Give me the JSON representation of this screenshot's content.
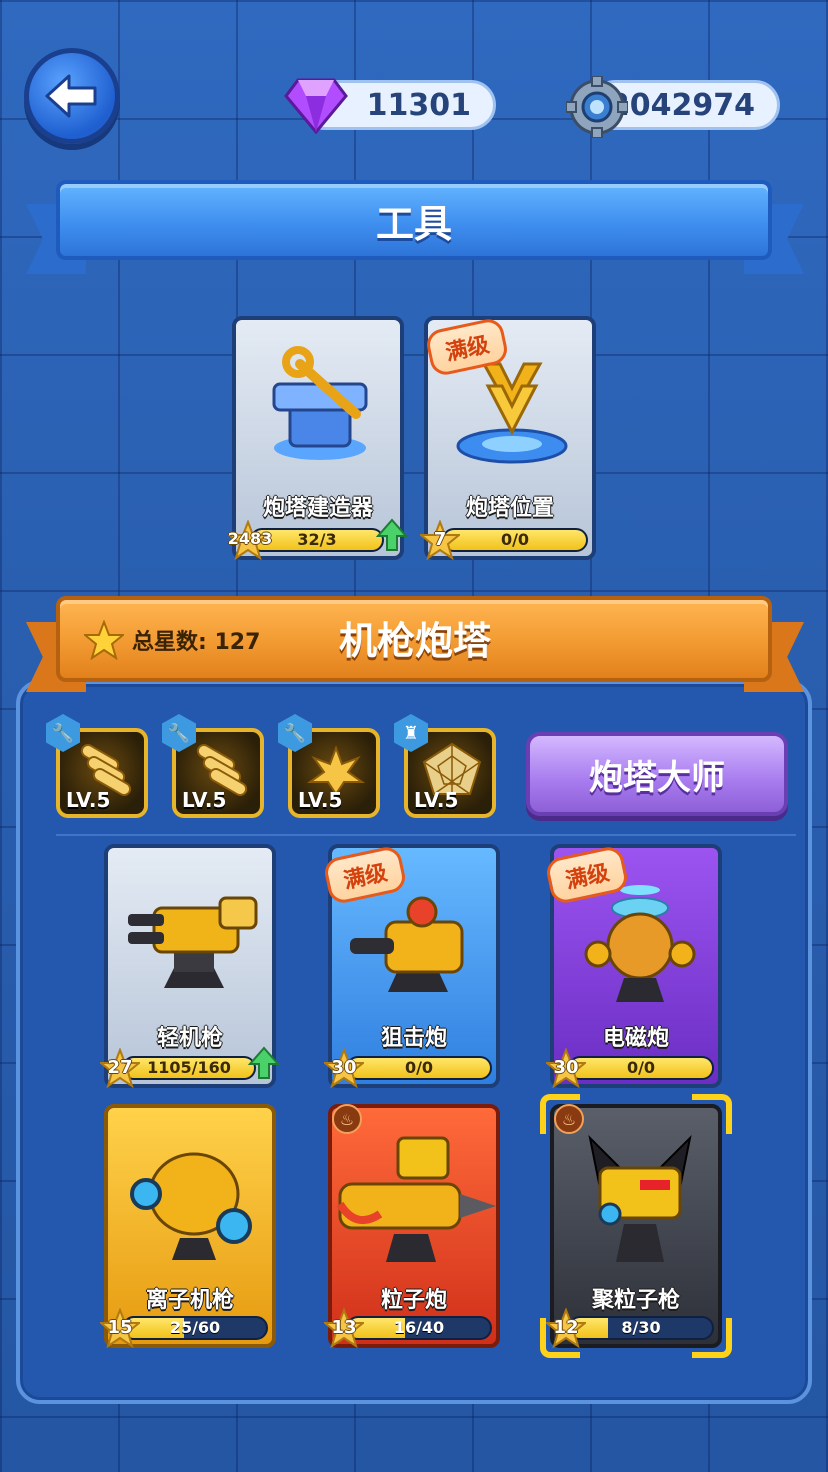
{
  "header": {
    "gems": "11301",
    "gears": "2042974"
  },
  "tools": {
    "title": "工具",
    "cards": [
      {
        "name": "炮塔建造器",
        "level": "2483",
        "progress_text": "32/3",
        "progress": 1.0,
        "upgradable": true,
        "max": false
      },
      {
        "name": "炮塔位置",
        "level": "7",
        "progress_text": "0/0",
        "progress": 1.0,
        "upgradable": false,
        "max": true,
        "max_label": "满级"
      }
    ]
  },
  "section": {
    "title": "机枪炮塔",
    "star_total_label": "总星数: 127"
  },
  "skills": [
    {
      "level": "LV.5",
      "badge": "wrench-icon"
    },
    {
      "level": "LV.5",
      "badge": "wrench-icon"
    },
    {
      "level": "LV.5",
      "badge": "wrench-icon"
    },
    {
      "level": "LV.5",
      "badge": "robot-icon"
    }
  ],
  "master_button": "炮塔大师",
  "turrets": [
    {
      "name": "轻机枪",
      "level": "27",
      "progress_text": "1105/160",
      "progress": 1.0,
      "upgradable": true,
      "max": false,
      "rarity": "silver"
    },
    {
      "name": "狙击炮",
      "level": "30",
      "progress_text": "0/0",
      "progress": 1.0,
      "max": true,
      "max_label": "满级",
      "rarity": "blue"
    },
    {
      "name": "电磁炮",
      "level": "30",
      "progress_text": "0/0",
      "progress": 1.0,
      "max": true,
      "max_label": "满级",
      "rarity": "purple"
    },
    {
      "name": "离子机枪",
      "level": "15",
      "progress_text": "25/60",
      "progress": 0.42,
      "max": false,
      "rarity": "gold"
    },
    {
      "name": "粒子炮",
      "level": "13",
      "progress_text": "16/40",
      "progress": 0.4,
      "max": false,
      "rarity": "red"
    },
    {
      "name": "聚粒子枪",
      "level": "12",
      "progress_text": "8/30",
      "progress": 0.27,
      "max": false,
      "rarity": "dark",
      "selected": true
    }
  ],
  "colors": {
    "accent_blue": "#3f8ff0",
    "accent_orange": "#f29a31",
    "progress_gold": "#f1c21a",
    "max_tag": "#e85a1a"
  }
}
